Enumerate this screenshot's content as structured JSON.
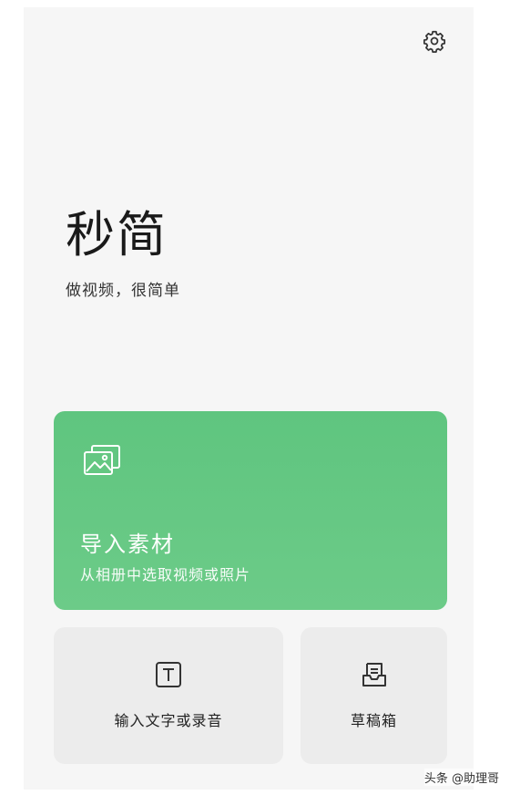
{
  "app": {
    "logo_text": "秒简",
    "tagline": "做视频，很简单"
  },
  "icons": {
    "settings": "gear-icon",
    "import": "image-gallery-icon",
    "text": "text-t-icon",
    "drafts": "drafts-box-icon"
  },
  "import_card": {
    "title": "导入素材",
    "subtitle": "从相册中选取视频或照片",
    "color": "#66c885"
  },
  "tiles": {
    "text_or_record": "输入文字或录音",
    "drafts": "草稿箱"
  },
  "watermark": "头条 @助理哥"
}
